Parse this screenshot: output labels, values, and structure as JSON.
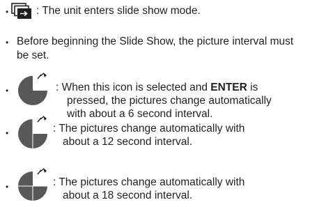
{
  "items": [
    {
      "icon": "slideshow-mode-icon",
      "text": ": The unit enters slide show mode."
    },
    {
      "line1": "Before beginning the Slide Show, the picture interval must",
      "line2": "be set."
    },
    {
      "icon": "interval-6s-icon",
      "pre": ": When this icon is selected and ",
      "bold": "ENTER",
      "post": " is",
      "line2": "pressed, the pictures change automatically",
      "line3": "with about a 6 second interval."
    },
    {
      "icon": "interval-12s-icon",
      "line1": ": The pictures change automatically with",
      "line2": "about a 12 second interval."
    },
    {
      "icon": "interval-18s-icon",
      "line1": ": The pictures change automatically with",
      "line2": "about a 18 second interval."
    }
  ]
}
